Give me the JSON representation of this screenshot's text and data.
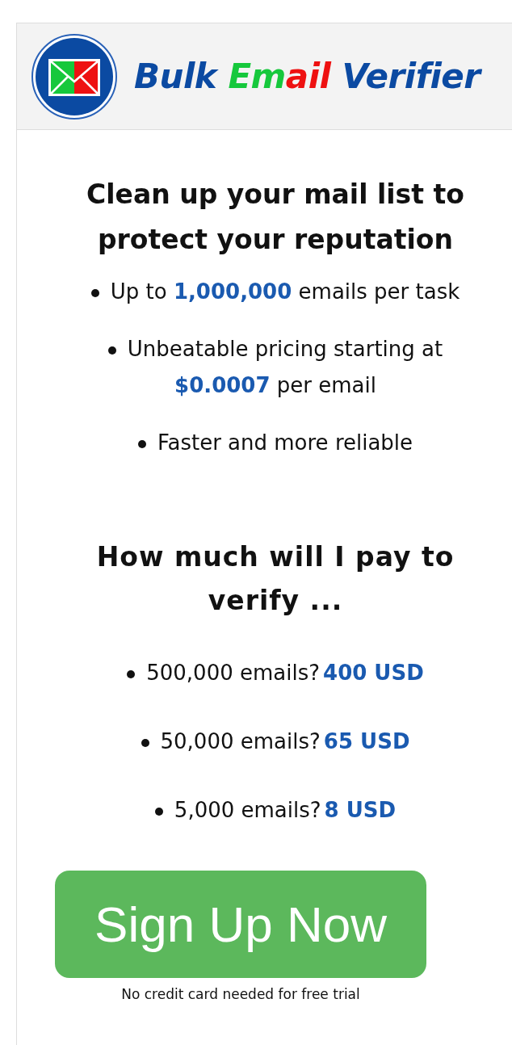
{
  "header": {
    "logo_text": [
      {
        "text": "Bulk ",
        "color": "#0b4aa2"
      },
      {
        "text": "Em",
        "color": "#16c83c"
      },
      {
        "text": "ail",
        "color": "#ee1111"
      },
      {
        "text": " Verifier",
        "color": "#0b4aa2"
      }
    ]
  },
  "headline": "Clean up your mail list to protect your reputation",
  "features": [
    "Up to **1,000,000** emails per task",
    "Unbeatable pricing starting at **$0.0007** per email",
    "Faster and more reliable"
  ],
  "pricing_heading": "How much will I pay to verify ...",
  "prices": [
    {
      "question": "500,000 emails?",
      "price": "400 USD"
    },
    {
      "question": "50,000 emails?",
      "price": "65 USD"
    },
    {
      "question": "5,000 emails?",
      "price": "8 USD"
    }
  ],
  "cta": {
    "button": "Sign Up Now",
    "note": "No credit card needed for free trial"
  }
}
